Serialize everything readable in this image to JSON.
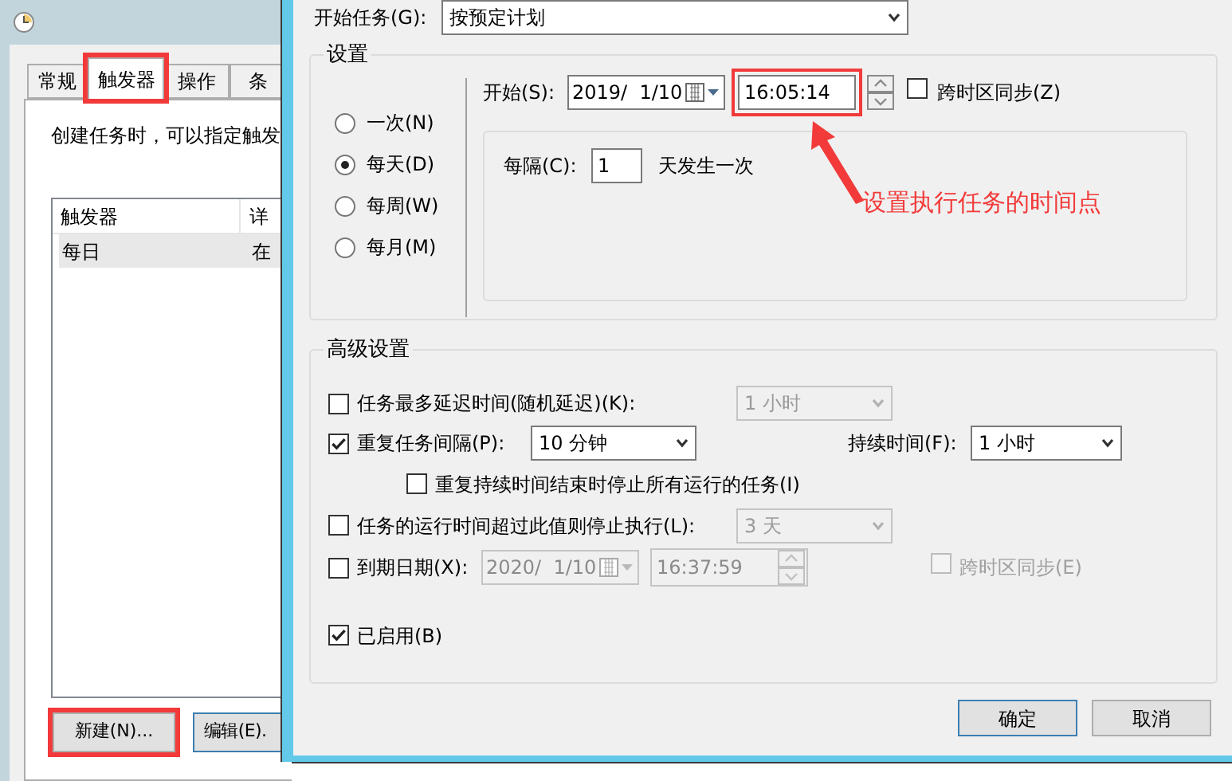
{
  "background_window": {
    "tabs": [
      {
        "label": "常规",
        "selected": false,
        "highlighted": false
      },
      {
        "label": "触发器",
        "selected": true,
        "highlighted": true
      },
      {
        "label": "操作",
        "selected": false,
        "highlighted": false
      },
      {
        "label": "条",
        "selected": false,
        "highlighted": false
      }
    ],
    "description": "创建任务时，可以指定触发",
    "table": {
      "columns": [
        "触发器",
        "详"
      ],
      "rows": [
        {
          "cells": [
            "每日",
            "在"
          ],
          "selected": true
        }
      ]
    },
    "buttons": [
      {
        "label": "新建(N)...",
        "highlighted": true
      },
      {
        "label": "编辑(E).",
        "highlighted": false
      }
    ]
  },
  "dialog": {
    "start_task": {
      "label": "开始任务(G):",
      "value": "按预定计划"
    },
    "settings": {
      "title": "设置",
      "schedule": [
        {
          "label": "一次(N)",
          "selected": false
        },
        {
          "label": "每天(D)",
          "selected": true
        },
        {
          "label": "每周(W)",
          "selected": false
        },
        {
          "label": "每月(M)",
          "selected": false
        }
      ],
      "start": {
        "label": "开始(S):",
        "date": "2019/  1/10",
        "time": "16:05:14",
        "time_highlighted": true,
        "sync_label": "跨时区同步(Z)",
        "sync_checked": false
      },
      "recur": {
        "label": "每隔(C):",
        "value": "1",
        "suffix": "天发生一次"
      }
    },
    "advanced": {
      "title": "高级设置",
      "delay": {
        "label": "任务最多延迟时间(随机延迟)(K):",
        "checked": false,
        "value": "1 小时",
        "disabled": true
      },
      "repeat": {
        "label": "重复任务间隔(P):",
        "checked": true,
        "value": "10 分钟",
        "duration_label": "持续时间(F):",
        "duration_value": "1 小时"
      },
      "stop_all": {
        "label": "重复持续时间结束时停止所有运行的任务(I)",
        "checked": false
      },
      "stop_after": {
        "label": "任务的运行时间超过此值则停止执行(L):",
        "checked": false,
        "value": "3 天",
        "disabled": true
      },
      "expire": {
        "label": "到期日期(X):",
        "checked": false,
        "date": "2020/  1/10",
        "time": "16:37:59",
        "sync_label": "跨时区同步(E)",
        "sync_checked": false,
        "disabled": true
      },
      "enabled": {
        "label": "已启用(B)",
        "checked": true
      }
    },
    "buttons": [
      {
        "label": "确定",
        "default": true
      },
      {
        "label": "取消",
        "default": false
      }
    ]
  },
  "annotation": {
    "text": "设置执行任务的时间点"
  }
}
